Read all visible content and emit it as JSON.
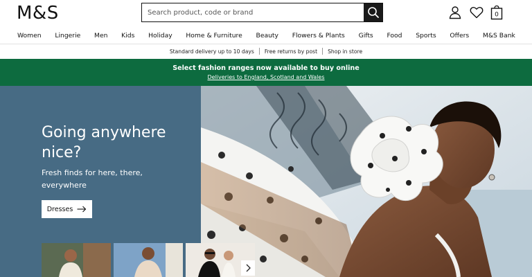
{
  "header": {
    "logo": "M&S",
    "search_placeholder": "Search product, code or brand",
    "icons": [
      "search-icon",
      "account-icon",
      "wishlist-heart-icon",
      "bag-icon"
    ],
    "bag_count": "0"
  },
  "nav": {
    "items": [
      "Women",
      "Lingerie",
      "Men",
      "Kids",
      "Holiday",
      "Home & Furniture",
      "Beauty",
      "Flowers & Plants",
      "Gifts",
      "Food",
      "Sports",
      "Offers",
      "M&S Bank"
    ]
  },
  "utility": {
    "items": [
      "Standard delivery up to 10 days",
      "Free returns by post",
      "Shop in store"
    ]
  },
  "banner": {
    "title": "Select fashion ranges now available to buy online",
    "link": "Deliveries to England, Scotland and Wales",
    "color": "#0d6b3f"
  },
  "hero": {
    "title": "Going anywhere nice?",
    "subtitle": "Fresh finds for here, there, everywhere",
    "cta": "Dresses",
    "panel_color": "#476b84"
  }
}
